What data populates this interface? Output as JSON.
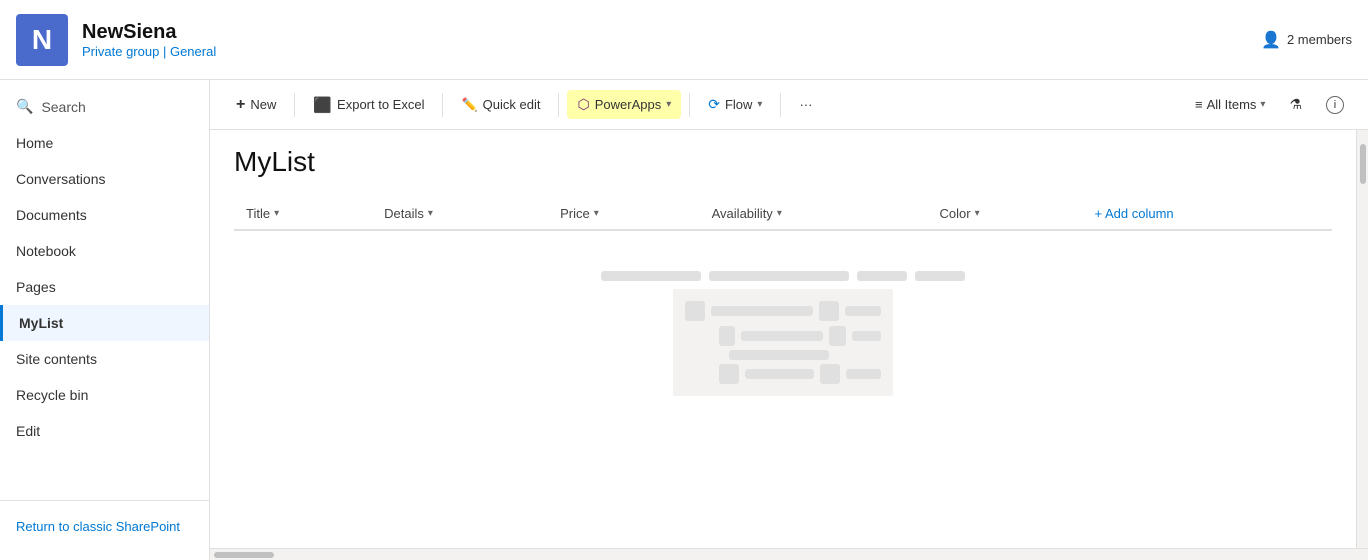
{
  "header": {
    "logo_letter": "N",
    "site_name": "NewSiena",
    "group_type": "Private group",
    "separator": " | ",
    "channel": "General",
    "members_count": "2 members"
  },
  "search": {
    "label": "Search"
  },
  "sidebar": {
    "items": [
      {
        "id": "home",
        "label": "Home"
      },
      {
        "id": "conversations",
        "label": "Conversations"
      },
      {
        "id": "documents",
        "label": "Documents"
      },
      {
        "id": "notebook",
        "label": "Notebook"
      },
      {
        "id": "pages",
        "label": "Pages"
      },
      {
        "id": "mylist",
        "label": "MyList",
        "active": true
      },
      {
        "id": "site-contents",
        "label": "Site contents"
      },
      {
        "id": "recycle-bin",
        "label": "Recycle bin"
      },
      {
        "id": "edit",
        "label": "Edit"
      }
    ],
    "return_label": "Return to classic SharePoint"
  },
  "toolbar": {
    "new_label": "New",
    "export_label": "Export to Excel",
    "quick_edit_label": "Quick edit",
    "powerapps_label": "PowerApps",
    "flow_label": "Flow",
    "more_label": "···",
    "all_items_label": "All Items",
    "filter_icon": "filter",
    "info_icon": "info"
  },
  "list": {
    "title": "MyList",
    "columns": [
      {
        "id": "title",
        "label": "Title"
      },
      {
        "id": "details",
        "label": "Details"
      },
      {
        "id": "price",
        "label": "Price"
      },
      {
        "id": "availability",
        "label": "Availability"
      },
      {
        "id": "color",
        "label": "Color"
      }
    ],
    "add_column_label": "+ Add column"
  }
}
